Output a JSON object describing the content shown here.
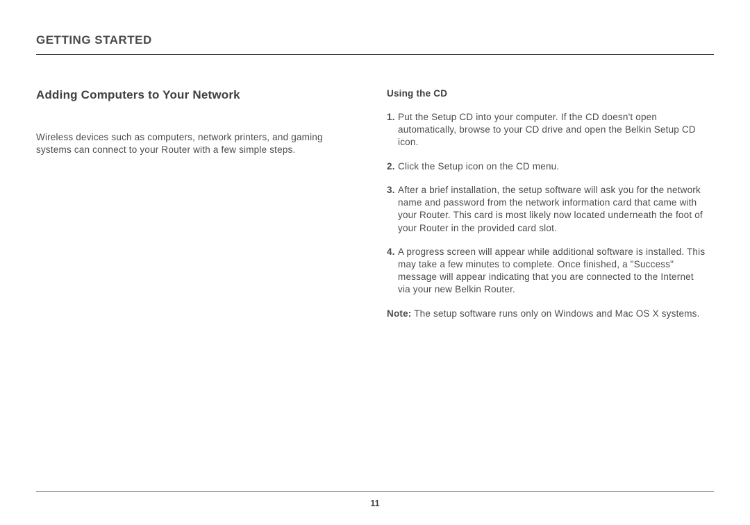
{
  "header": {
    "section_title": "GETTING STARTED"
  },
  "left": {
    "title": "Adding Computers to Your Network",
    "intro": "Wireless devices such as computers, network printers, and gaming systems can connect to your Router with a few simple steps."
  },
  "right": {
    "heading": "Using the CD",
    "steps": [
      {
        "num": "1.",
        "text": "Put the Setup CD into your computer. If the CD doesn't open automatically, browse to your CD drive and open the Belkin Setup CD icon."
      },
      {
        "num": "2.",
        "text": "Click the Setup icon on the CD menu."
      },
      {
        "num": "3.",
        "text": "After a brief installation, the setup software will ask you for the network name and password from the network information card that came with your Router. This card is most likely now located underneath the foot of your Router in the provided card slot."
      },
      {
        "num": "4.",
        "text": "A progress screen will appear while additional software is installed. This may take a few minutes to complete. Once finished, a \"Success\" message will appear indicating that you are connected to the Internet via your new Belkin Router."
      }
    ],
    "note_label": "Note:",
    "note_text": " The setup software runs only on Windows and Mac OS X systems."
  },
  "footer": {
    "page_number": "11"
  }
}
